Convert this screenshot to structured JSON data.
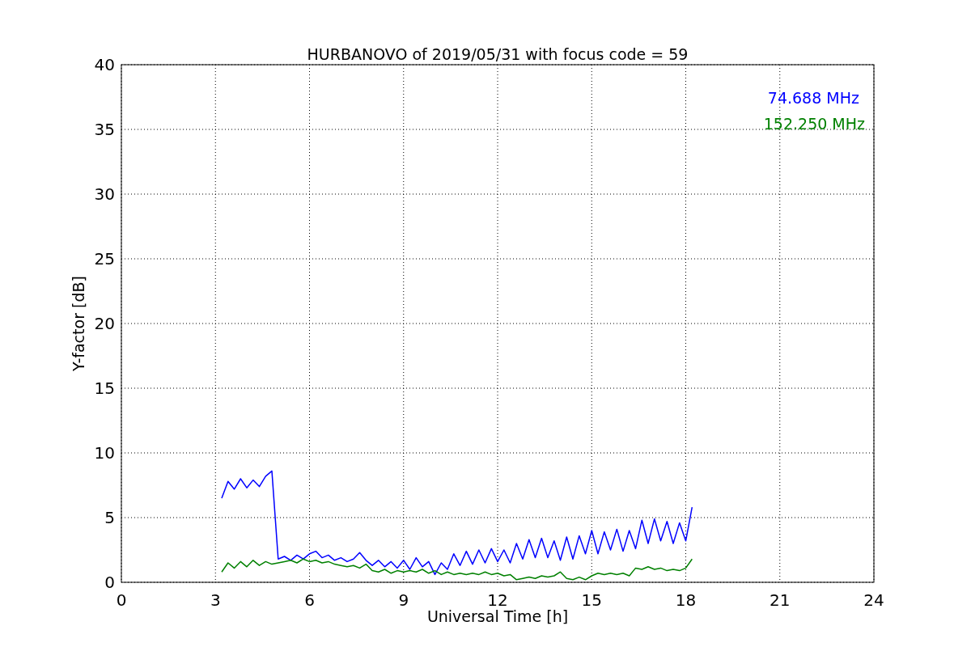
{
  "chart_data": {
    "type": "line",
    "title": "HURBANOVO of 2019/05/31 with focus code = 59",
    "xlabel": "Universal Time [h]",
    "ylabel": "Y-factor [dB]",
    "xlim": [
      0,
      24
    ],
    "ylim": [
      0,
      40
    ],
    "xticks": [
      0,
      3,
      6,
      9,
      12,
      15,
      18,
      21,
      24
    ],
    "yticks": [
      0,
      5,
      10,
      15,
      20,
      25,
      30,
      35,
      40
    ],
    "grid": true,
    "x": [
      3.2,
      3.4,
      3.6,
      3.8,
      4.0,
      4.2,
      4.4,
      4.6,
      4.8,
      5.0,
      5.2,
      5.4,
      5.6,
      5.8,
      6.0,
      6.2,
      6.4,
      6.6,
      6.8,
      7.0,
      7.2,
      7.4,
      7.6,
      7.8,
      8.0,
      8.2,
      8.4,
      8.6,
      8.8,
      9.0,
      9.2,
      9.4,
      9.6,
      9.8,
      10.0,
      10.2,
      10.4,
      10.6,
      10.8,
      11.0,
      11.2,
      11.4,
      11.6,
      11.8,
      12.0,
      12.2,
      12.4,
      12.6,
      12.8,
      13.0,
      13.2,
      13.4,
      13.6,
      13.8,
      14.0,
      14.2,
      14.4,
      14.6,
      14.8,
      15.0,
      15.2,
      15.4,
      15.6,
      15.8,
      16.0,
      16.2,
      16.4,
      16.6,
      16.8,
      17.0,
      17.2,
      17.4,
      17.6,
      17.8,
      18.0,
      18.2
    ],
    "series": [
      {
        "name": "74.688 MHz",
        "color": "#0000ff",
        "values": [
          6.5,
          7.8,
          7.2,
          8.0,
          7.3,
          7.9,
          7.4,
          8.2,
          8.6,
          1.8,
          2.0,
          1.7,
          2.1,
          1.8,
          2.2,
          2.4,
          1.9,
          2.1,
          1.7,
          1.9,
          1.6,
          1.8,
          2.3,
          1.7,
          1.3,
          1.7,
          1.2,
          1.6,
          1.1,
          1.7,
          1.0,
          1.9,
          1.2,
          1.6,
          0.6,
          1.5,
          1.0,
          2.2,
          1.3,
          2.4,
          1.4,
          2.5,
          1.5,
          2.6,
          1.6,
          2.5,
          1.5,
          3.0,
          1.8,
          3.3,
          1.9,
          3.4,
          1.9,
          3.2,
          1.7,
          3.5,
          1.8,
          3.6,
          2.2,
          4.0,
          2.2,
          3.9,
          2.5,
          4.1,
          2.4,
          4.0,
          2.6,
          4.8,
          3.0,
          4.9,
          3.2,
          4.7,
          3.0,
          4.6,
          3.2,
          5.8
        ]
      },
      {
        "name": "152.250 MHz",
        "color": "#008000",
        "values": [
          0.8,
          1.5,
          1.1,
          1.6,
          1.2,
          1.7,
          1.3,
          1.6,
          1.4,
          1.5,
          1.6,
          1.7,
          1.5,
          1.8,
          1.6,
          1.7,
          1.5,
          1.6,
          1.4,
          1.3,
          1.2,
          1.3,
          1.1,
          1.4,
          0.9,
          0.8,
          1.0,
          0.7,
          0.9,
          0.8,
          0.9,
          0.8,
          1.0,
          0.7,
          0.9,
          0.6,
          0.8,
          0.6,
          0.7,
          0.6,
          0.7,
          0.6,
          0.8,
          0.6,
          0.7,
          0.5,
          0.6,
          0.2,
          0.3,
          0.4,
          0.3,
          0.5,
          0.4,
          0.5,
          0.8,
          0.3,
          0.2,
          0.4,
          0.2,
          0.5,
          0.7,
          0.6,
          0.7,
          0.6,
          0.7,
          0.5,
          1.1,
          1.0,
          1.2,
          1.0,
          1.1,
          0.9,
          1.0,
          0.9,
          1.1,
          1.8
        ]
      }
    ]
  }
}
